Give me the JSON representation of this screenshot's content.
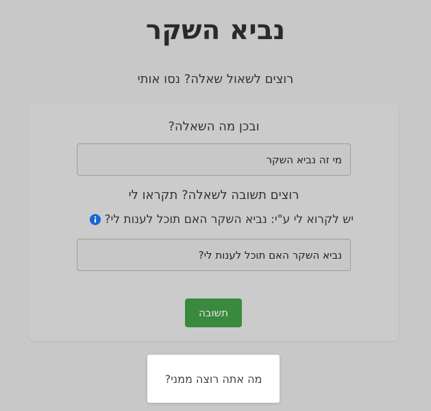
{
  "header": {
    "title": "נביא השקר",
    "subtitle": "רוצים לשאול שאלה? נסו אותי"
  },
  "form": {
    "question_label": "ובכן מה השאלה?",
    "question_value": "מי זה נביא השקר",
    "answer_label": "רוצים תשובה לשאלה? תקראו לי",
    "hint_text": "יש לקרוא לי ע\"י: נביא השקר האם תוכל לענות לי?",
    "hint_icon": "info-icon",
    "call_value": "נביא השקר האם תוכל לענות לי?",
    "submit_label": "תשובה"
  },
  "response": {
    "text": "מה אתה רוצה ממני?"
  },
  "colors": {
    "background": "#c8c8c8",
    "button": "#3a8a3e",
    "info_icon": "#1766d6"
  }
}
